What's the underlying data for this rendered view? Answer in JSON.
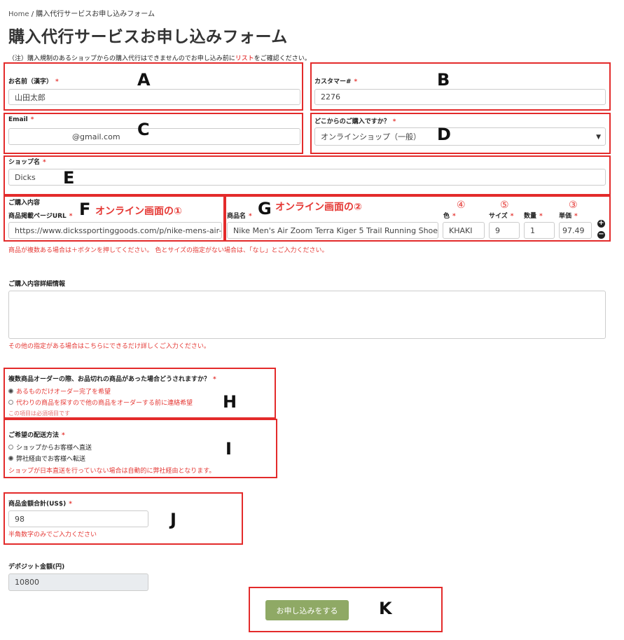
{
  "breadcrumb": {
    "home": "Home",
    "sep": " / ",
    "current": "購入代行サービスお申し込みフォーム"
  },
  "page_title": "購入代行サービスお申し込みフォーム",
  "notice": {
    "prefix": "（注）購入規制のあるショップからの購入代行はできませんのでお申し込み前に",
    "link": "リスト",
    "suffix": "をご確認ください。"
  },
  "required_mark": "*",
  "name": {
    "label": "お名前（漢字）",
    "value": "山田太郎"
  },
  "customer": {
    "label": "カスタマー#",
    "value": "2276"
  },
  "email": {
    "label": "Email",
    "value": "@gmail.com"
  },
  "source": {
    "label": "どこからのご購入ですか？",
    "selected": "オンラインショップ（一般）"
  },
  "shop": {
    "label": "ショップ名",
    "value": "Dicks"
  },
  "order": {
    "section_label": "ご購入内容",
    "url_label": "商品掲載ページURL",
    "url_value": "https://www.dickssportinggoods.com/p/nike-mens-air-",
    "product_label": "商品名",
    "product_value": "Nike Men's Air Zoom Terra Kiger 5 Trail Running Shoes",
    "color_label": "色",
    "color_value": "KHAKI",
    "size_label": "サイズ",
    "size_value": "9",
    "qty_label": "数量",
    "qty_value": "1",
    "price_label": "単価",
    "price_value": "97.49",
    "plus": "+",
    "minus": "−",
    "help": "商品が複数ある場合は＋ボタンを押してください。 色とサイズの指定がない場合は、「なし」とご入力ください。"
  },
  "details": {
    "label": "ご購入内容詳細情報",
    "help": "その他の指定がある場合はこちらにできるだけ詳しくご入力ください。"
  },
  "stockout": {
    "label": "複数商品オーダーの際、お品切れの商品があった場合どうされますか？",
    "options": [
      "あるものだけオーダー完了を希望",
      "代わりの商品を探すので他の商品をオーダーする前に連絡希望"
    ],
    "help": "この項目は必須項目です"
  },
  "shipping": {
    "label": "ご希望の配送方法",
    "options": [
      "ショップからお客様へ直送",
      "弊社経由でお客様へ転送"
    ],
    "help": "ショップが日本直送を行っていない場合は自動的に弊社経由となります。"
  },
  "total": {
    "label": "商品金額合計(US$)",
    "value": "98",
    "help": "半角数字のみでご入力ください"
  },
  "deposit": {
    "label": "デポジット金額(円)",
    "value": "10800"
  },
  "submit_label": "お申し込みをする",
  "annotations": {
    "letters": [
      "A",
      "B",
      "C",
      "D",
      "E",
      "F",
      "G",
      "H",
      "I",
      "J",
      "K"
    ],
    "online1": "オンライン画面の①",
    "online2": "オンライン画面の②",
    "n4": "④",
    "n5": "⑤",
    "n3": "③"
  },
  "colors": {
    "annotation_red": "#e32b2b",
    "required_red": "#e53935",
    "submit_green": "#8fa965"
  }
}
